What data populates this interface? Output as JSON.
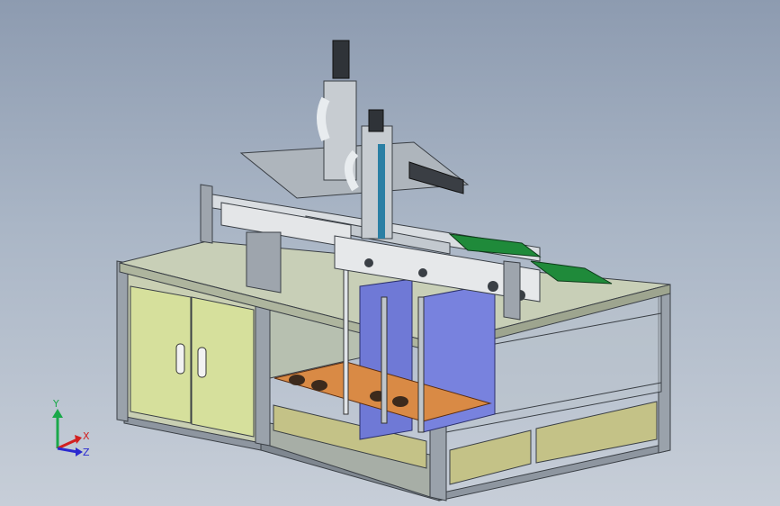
{
  "viewport": {
    "background_top": "#8d9bb0",
    "background_bottom": "#c7ced8"
  },
  "model": {
    "description_colors": {
      "frame": "#9aa2ab",
      "tabletop": "#c9d0b8",
      "cabinet_door": "#d3dd9b",
      "lower_panel": "#c6c48a",
      "blue_plate": "#6f79d6",
      "orange_tray": "#d98a45",
      "green_belt": "#1f8a3a"
    }
  },
  "triad": {
    "x_label": "X",
    "y_label": "Y",
    "z_label": "Z",
    "x_color": "#d22020",
    "y_color": "#1aa84a",
    "z_color": "#2a2ad0"
  }
}
